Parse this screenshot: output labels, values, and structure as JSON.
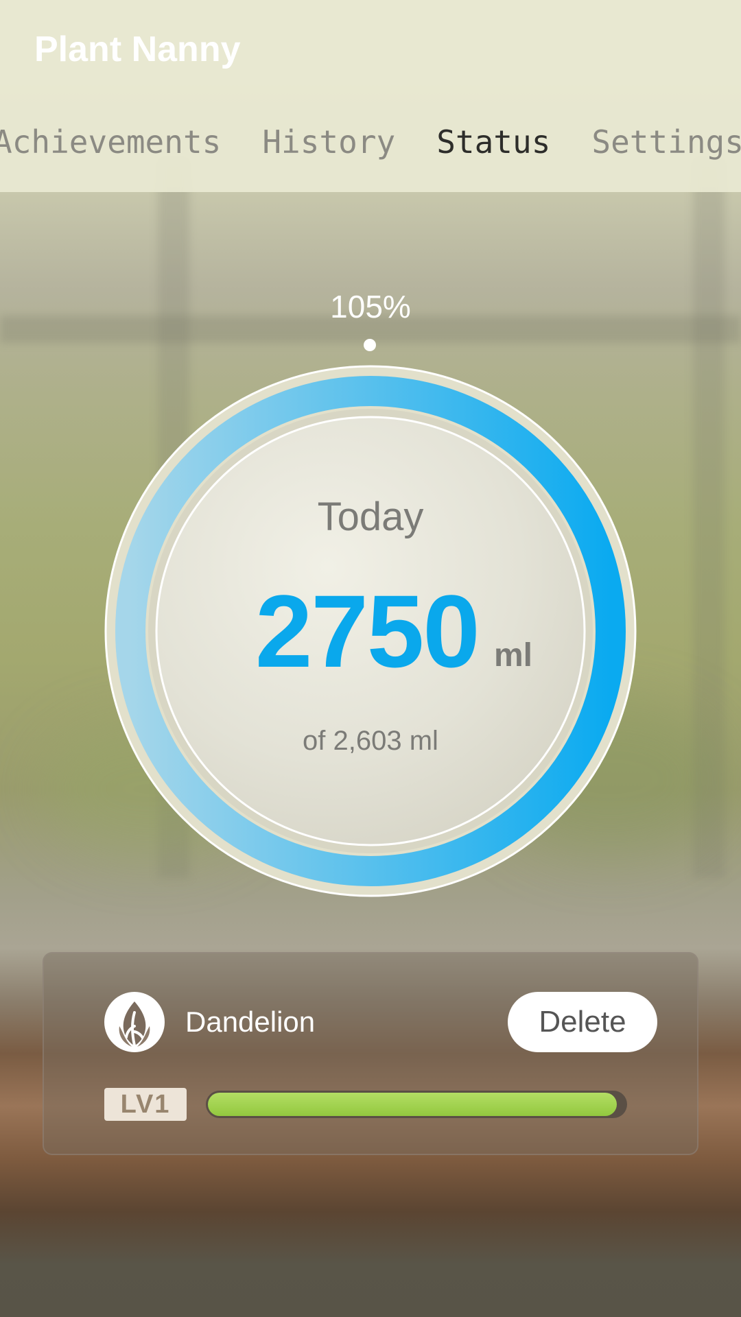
{
  "app": {
    "title": "Plant Nanny"
  },
  "tabs": [
    {
      "label": "Achievements",
      "active": false
    },
    {
      "label": "History",
      "active": false
    },
    {
      "label": "Status",
      "active": true
    },
    {
      "label": "Settings",
      "active": false
    }
  ],
  "gauge": {
    "percent_label": "105%",
    "progress_fraction": 1.0,
    "today_label": "Today",
    "amount": "2750",
    "unit": "ml",
    "goal_label": "of 2,603 ml",
    "colors": {
      "ring_top": "#a5d6ea",
      "ring_bottom": "#0aaaf0",
      "value": "#0aa8ec"
    }
  },
  "plant": {
    "name": "Dandelion",
    "icon": "leaf-icon",
    "delete_label": "Delete",
    "level_label": "LV1",
    "level_progress": 0.98,
    "level_color": "#9ccd4a"
  }
}
